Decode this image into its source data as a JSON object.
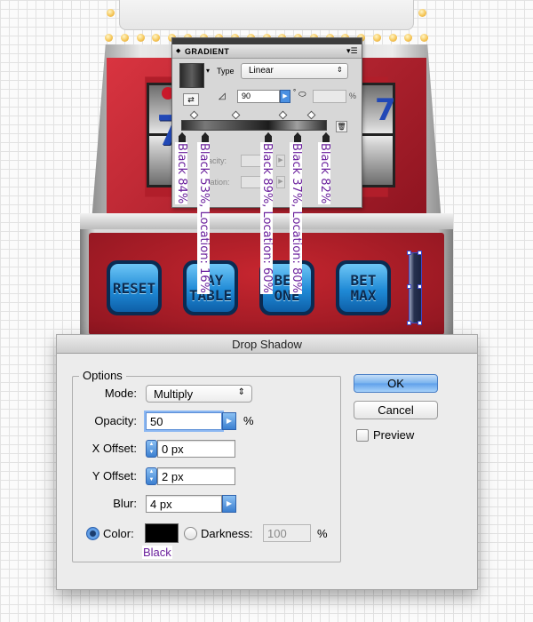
{
  "gradient_panel": {
    "title": "GRADIENT",
    "collapse_arrow": "◆",
    "menu_icon": "▾☰",
    "type_label": "Type",
    "type_value": "Linear",
    "angle_value": "90",
    "degree_symbol": "°",
    "aspect_percent": "%",
    "opacity_label": "Opacity:",
    "location_label": "Location:"
  },
  "stop_labels": [
    "Black 84%",
    "Black 53%, Location: 16%",
    "Black 89%, Location: 60%",
    "Black 37%, Location: 80%",
    "Black 82%"
  ],
  "machine_buttons": [
    {
      "label": "RESET"
    },
    {
      "label": "PAY TABLE"
    },
    {
      "label": "BET ONE"
    },
    {
      "label": "BET MAX"
    }
  ],
  "drop_shadow": {
    "title": "Drop Shadow",
    "options_legend": "Options",
    "mode_label": "Mode:",
    "mode_value": "Multiply",
    "opacity_label": "Opacity:",
    "opacity_value": "50",
    "opacity_unit": "%",
    "x_offset_label": "X Offset:",
    "x_offset_value": "0 px",
    "y_offset_label": "Y Offset:",
    "y_offset_value": "2 px",
    "blur_label": "Blur:",
    "blur_value": "4 px",
    "color_label": "Color:",
    "color_value": "#000000",
    "color_caption": "Black",
    "darkness_label": "Darkness:",
    "darkness_value": "100",
    "darkness_unit": "%",
    "ok_label": "OK",
    "cancel_label": "Cancel",
    "preview_label": "Preview"
  },
  "colors": {
    "annotation": "#6a1f9c",
    "cabinet_red": "#b11e2a",
    "button_blue": "#1f8ad6",
    "selection": "#3b48c7"
  }
}
